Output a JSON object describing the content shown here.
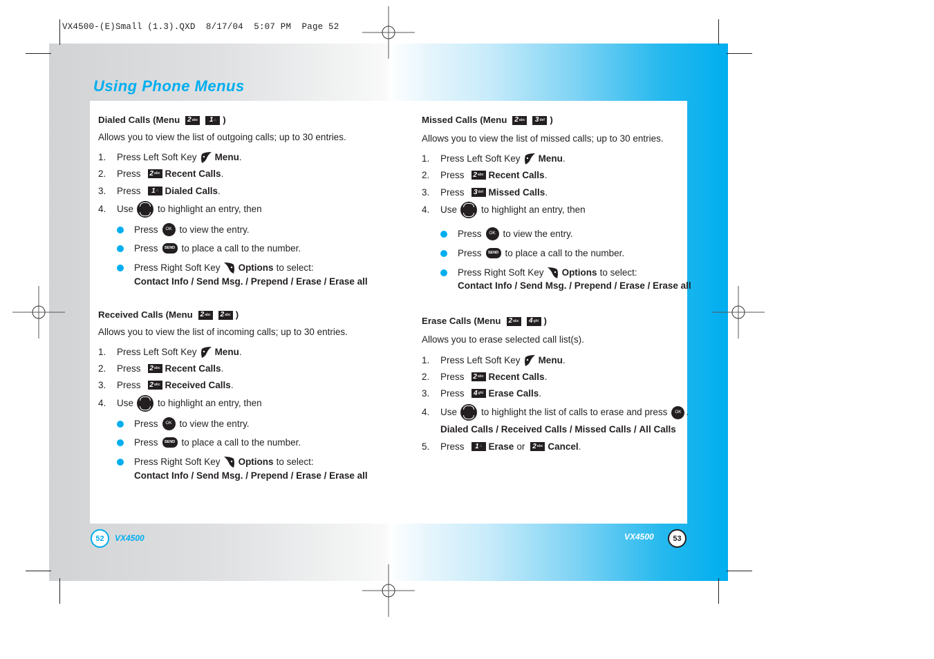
{
  "slug": "VX4500-(E)Small (1.3).QXD  8/17/04  5:07 PM  Page 52",
  "page_title": "Using Phone Menus",
  "colors": {
    "accent": "#00aeef",
    "text": "#231f20"
  },
  "icons": {
    "left_soft_key": "left-soft-key-icon",
    "right_soft_key": "right-soft-key-icon",
    "nav_key": "navigation-key-icon",
    "ok_key": "ok-key-icon",
    "send_key": "send-key-icon"
  },
  "keys": {
    "k1": {
      "digit": "1",
      "sub": "∴"
    },
    "k2": {
      "digit": "2",
      "sub": "abc"
    },
    "k3": {
      "digit": "3",
      "sub": "def"
    },
    "k4": {
      "digit": "4",
      "sub": "ghi"
    },
    "ok_label": "OK",
    "send_label": "SEND"
  },
  "sections": {
    "dialed": {
      "heading": "Dialed Calls (Menu",
      "heading_close": ")",
      "description": "Allows you to view the list of outgoing calls; up to 30 entries.",
      "steps": [
        {
          "num": "1.",
          "pre": "Press Left Soft Key",
          "bold": "Menu",
          "post": "."
        },
        {
          "num": "2.",
          "pre": "Press",
          "bold": "Recent Calls",
          "post": "."
        },
        {
          "num": "3.",
          "pre": "Press",
          "bold": "Dialed Calls",
          "post": "."
        },
        {
          "num": "4.",
          "pre": "Use",
          "post": "to highlight an entry, then"
        }
      ],
      "bullets": [
        {
          "pre": "Press",
          "post": "to view the entry."
        },
        {
          "pre": "Press",
          "post": "to place a call to the number."
        },
        {
          "pre": "Press Right Soft Key",
          "bold": "Options",
          "post": "to select:"
        }
      ],
      "options": [
        "Contact Info",
        "Send Msg.",
        "Prepend",
        "Erase",
        "Erase all"
      ]
    },
    "received": {
      "heading": "Received Calls (Menu",
      "heading_close": ")",
      "description": "Allows you to view the list of incoming calls; up to 30 entries.",
      "steps": [
        {
          "num": "1.",
          "pre": "Press Left Soft Key",
          "bold": "Menu",
          "post": "."
        },
        {
          "num": "2.",
          "pre": "Press",
          "bold": "Recent Calls",
          "post": "."
        },
        {
          "num": "3.",
          "pre": "Press",
          "bold": "Received Calls",
          "post": "."
        },
        {
          "num": "4.",
          "pre": "Use",
          "post": "to highlight an entry, then"
        }
      ],
      "bullets": [
        {
          "pre": "Press",
          "post": "to view the entry."
        },
        {
          "pre": "Press",
          "post": "to place a call to the number."
        },
        {
          "pre": "Press Right Soft Key",
          "bold": "Options",
          "post": "to select:"
        }
      ],
      "options": [
        "Contact Info",
        "Send Msg.",
        "Prepend",
        "Erase",
        "Erase all"
      ]
    },
    "missed": {
      "heading": "Missed Calls (Menu",
      "heading_close": ")",
      "description": "Allows you to view the list of missed calls; up to 30 entries.",
      "steps": [
        {
          "num": "1.",
          "pre": "Press Left Soft Key",
          "bold": "Menu",
          "post": "."
        },
        {
          "num": "2.",
          "pre": "Press",
          "bold": "Recent Calls",
          "post": "."
        },
        {
          "num": "3.",
          "pre": "Press",
          "bold": "Missed Calls",
          "post": "."
        },
        {
          "num": "4.",
          "pre": "Use",
          "post": "to highlight an entry, then"
        }
      ],
      "bullets": [
        {
          "pre": "Press",
          "post": "to view the entry."
        },
        {
          "pre": "Press",
          "post": "to place a call to the number."
        },
        {
          "pre": "Press Right Soft Key",
          "bold": "Options",
          "post": "to select:"
        }
      ],
      "options": [
        "Contact Info",
        "Send Msg.",
        "Prepend",
        "Erase",
        "Erase all"
      ]
    },
    "erase": {
      "heading": "Erase Calls (Menu",
      "heading_close": ")",
      "description": "Allows you to erase selected call list(s).",
      "steps": [
        {
          "num": "1.",
          "pre": "Press Left Soft Key",
          "bold": "Menu",
          "post": "."
        },
        {
          "num": "2.",
          "pre": "Press",
          "bold": "Recent Calls",
          "post": "."
        },
        {
          "num": "3.",
          "pre": "Press",
          "bold": "Erase Calls",
          "post": "."
        },
        {
          "num": "4.",
          "pre": "Use",
          "post": "to highlight the list of calls to erase and press",
          "post2": "."
        },
        {
          "num": "5.",
          "pre": "Press",
          "bold": "Erase",
          "mid": "or",
          "bold2": "Cancel",
          "post": "."
        }
      ],
      "options": [
        "Dialed Calls",
        "Received Calls",
        "Missed Calls",
        "All Calls"
      ]
    }
  },
  "footer": {
    "left_page": "52",
    "right_page": "53",
    "model": "VX4500"
  }
}
